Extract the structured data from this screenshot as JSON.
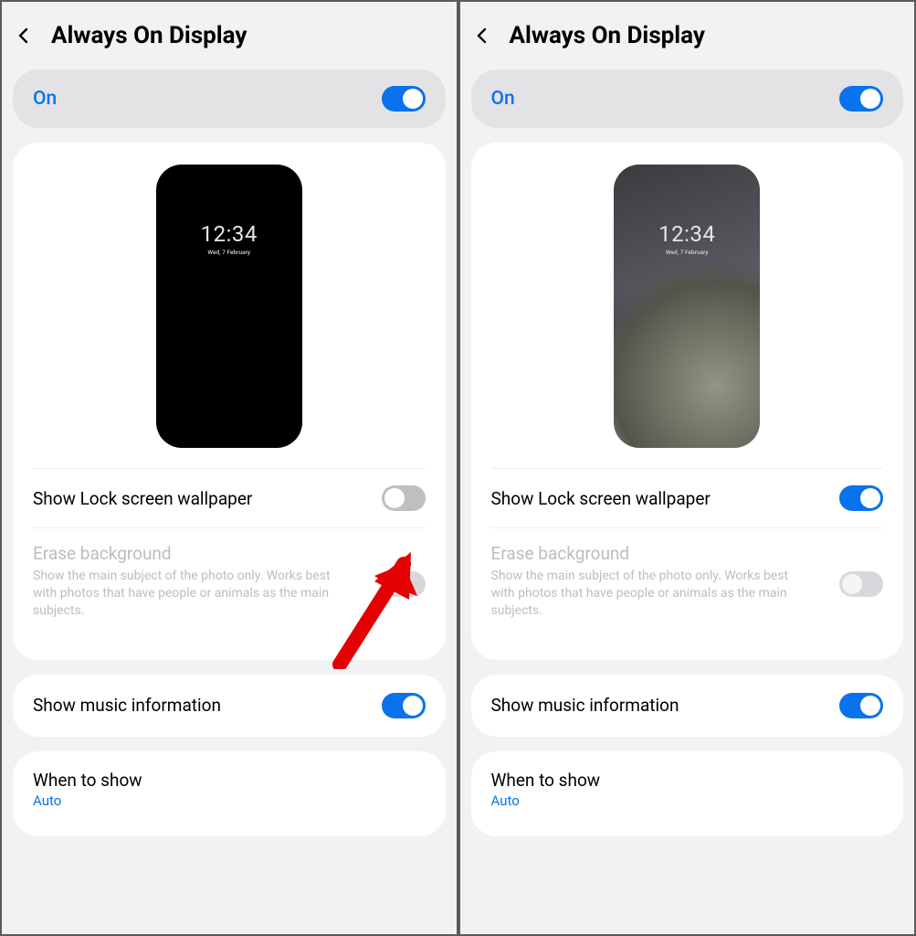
{
  "panes": [
    {
      "title": "Always On Display",
      "master": {
        "label": "On",
        "enabled": true
      },
      "preview": {
        "time": "12:34",
        "date": "Wed, 7 February",
        "wallpaper": false
      },
      "showWallpaper": {
        "label": "Show Lock screen wallpaper",
        "enabled": false
      },
      "eraseBg": {
        "label": "Erase background",
        "desc": "Show the main subject of the photo only. Works best with photos that have people or animals as the main subjects.",
        "enabled": false,
        "disabled": true
      },
      "music": {
        "label": "Show music information",
        "enabled": true
      },
      "whenToShow": {
        "label": "When to show",
        "value": "Auto"
      }
    },
    {
      "title": "Always On Display",
      "master": {
        "label": "On",
        "enabled": true
      },
      "preview": {
        "time": "12:34",
        "date": "Wed, 7 February",
        "wallpaper": true
      },
      "showWallpaper": {
        "label": "Show Lock screen wallpaper",
        "enabled": true
      },
      "eraseBg": {
        "label": "Erase background",
        "desc": "Show the main subject of the photo only. Works best with photos that have people or animals as the main subjects.",
        "enabled": false,
        "disabled": true
      },
      "music": {
        "label": "Show music information",
        "enabled": true
      },
      "whenToShow": {
        "label": "When to show",
        "value": "Auto"
      }
    }
  ]
}
